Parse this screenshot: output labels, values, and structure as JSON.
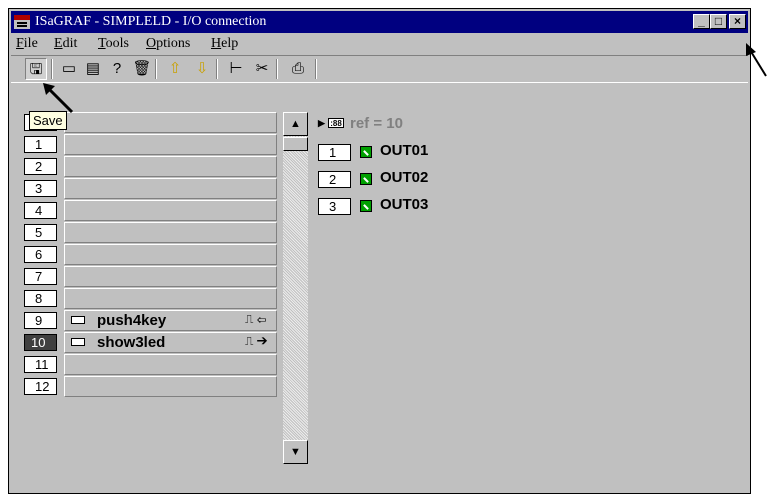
{
  "window": {
    "title": "ISaGRAF - SIMPLELD - I/O connection",
    "controls": {
      "minimize": "_",
      "maximize": "□",
      "close": "×"
    }
  },
  "menu": [
    {
      "label": "File",
      "key": "F",
      "rest": "ile"
    },
    {
      "label": "Edit",
      "key": "E",
      "rest": "dit"
    },
    {
      "label": "Tools",
      "key": "T",
      "rest": "ools"
    },
    {
      "label": "Options",
      "key": "O",
      "rest": "ptions"
    },
    {
      "label": "Help",
      "key": "H",
      "rest": "elp"
    }
  ],
  "toolbar": {
    "tools": [
      {
        "icon": "save-icon",
        "glyph": "🖫"
      },
      {
        "icon": "board-icon",
        "glyph": "▭"
      },
      {
        "icon": "board-edit-icon",
        "glyph": "▤"
      },
      {
        "icon": "board-help-icon",
        "glyph": "?"
      },
      {
        "icon": "trash-icon",
        "glyph": "🗑"
      },
      {
        "icon": "arrow-up-icon",
        "glyph": "⇧"
      },
      {
        "icon": "arrow-down-icon",
        "glyph": "⇩"
      },
      {
        "icon": "tree-icon",
        "glyph": "⊢"
      },
      {
        "icon": "cut-icon",
        "glyph": "✂"
      },
      {
        "icon": "print-icon",
        "glyph": "⎙"
      }
    ],
    "tooltip": "Save"
  },
  "slots": [
    {
      "number": "",
      "name": ""
    },
    {
      "number": "1",
      "name": ""
    },
    {
      "number": "2",
      "name": ""
    },
    {
      "number": "3",
      "name": ""
    },
    {
      "number": "4",
      "name": ""
    },
    {
      "number": "5",
      "name": ""
    },
    {
      "number": "6",
      "name": ""
    },
    {
      "number": "7",
      "name": ""
    },
    {
      "number": "8",
      "name": ""
    },
    {
      "number": "9",
      "name": "push4key",
      "flag": "⎍ ⇦"
    },
    {
      "number": "10",
      "name": "show3led",
      "flag": "⎍ ➔",
      "selected": true
    },
    {
      "number": "11",
      "name": ""
    },
    {
      "number": "12",
      "name": ""
    }
  ],
  "details": {
    "ref": "ref = 10",
    "ref_icon_text": ":88",
    "outputs": [
      {
        "number": "1",
        "name": "OUT01"
      },
      {
        "number": "2",
        "name": "OUT02"
      },
      {
        "number": "3",
        "name": "OUT03"
      }
    ]
  },
  "colors": {
    "titlebar": "#000080",
    "face": "#c0c0c0",
    "output-ok": "#00a000"
  }
}
